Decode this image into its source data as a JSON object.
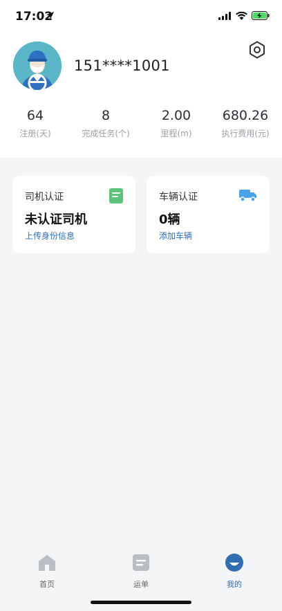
{
  "status_bar": {
    "time": "17:02"
  },
  "profile": {
    "phone": "151****1001"
  },
  "stats": [
    {
      "value": "64",
      "label": "注册(天)"
    },
    {
      "value": "8",
      "label": "完成任务(个)"
    },
    {
      "value": "2.00",
      "label": "里程(m)"
    },
    {
      "value": "680.26",
      "label": "执行费用(元)"
    }
  ],
  "cards": {
    "driver": {
      "title": "司机认证",
      "value": "未认证司机",
      "link": "上传身份信息",
      "icon": "document-icon"
    },
    "vehicle": {
      "title": "车辆认证",
      "value": "0辆",
      "link": "添加车辆",
      "icon": "truck-icon"
    }
  },
  "tabs": [
    {
      "label": "首页",
      "icon": "home-icon"
    },
    {
      "label": "运单",
      "icon": "waybill-icon"
    },
    {
      "label": "我的",
      "icon": "profile-icon"
    }
  ],
  "colors": {
    "accent": "#2f6fb1",
    "document_icon": "#5cc37a",
    "truck_icon": "#4aa3e8",
    "avatar_bg": "#5ab6c6"
  }
}
